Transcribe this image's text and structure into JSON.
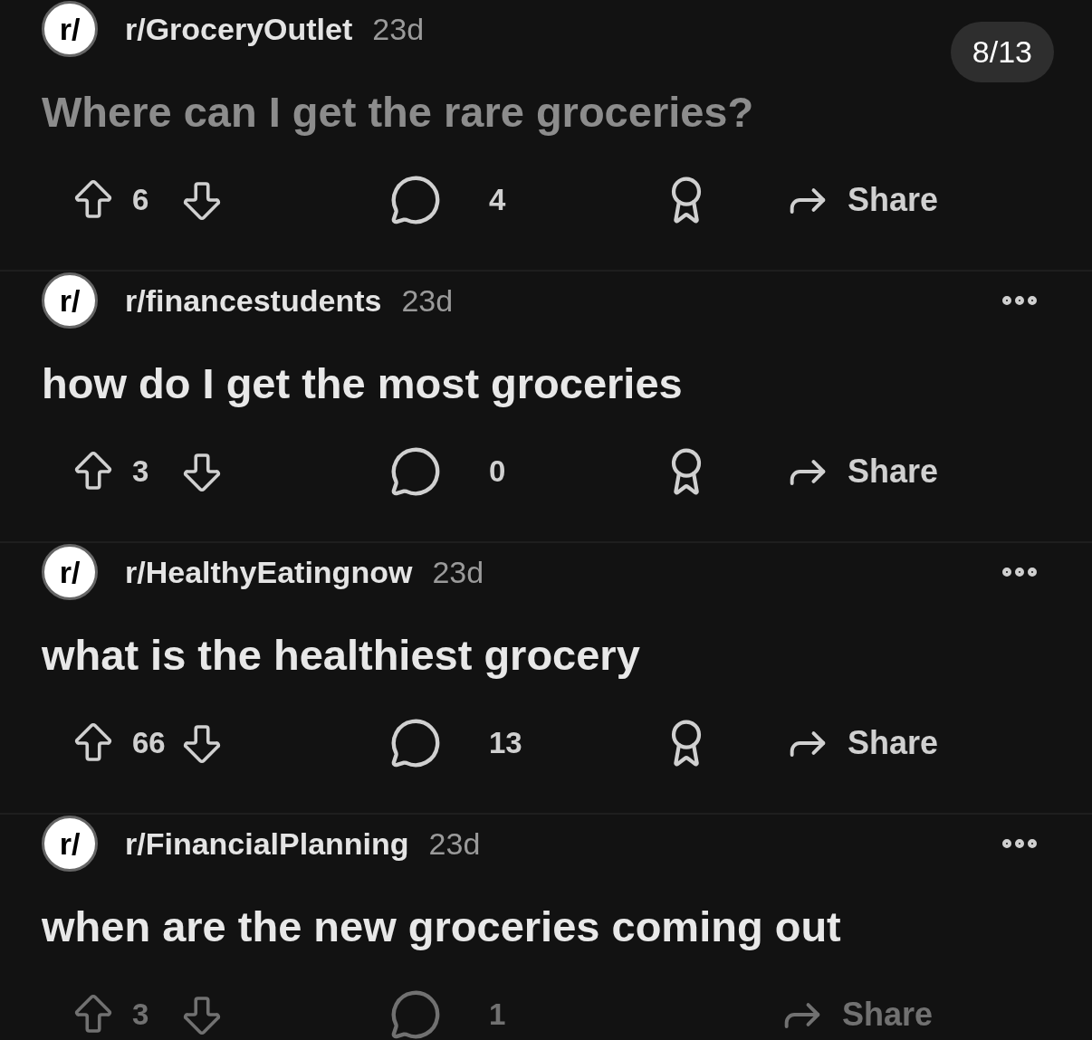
{
  "page_counter": "8/13",
  "posts": [
    {
      "icon_text": "r/",
      "subreddit": "r/GroceryOutlet",
      "age": "23d",
      "title": "Where can I get the rare groceries?",
      "visited": true,
      "more_menu": false,
      "upvotes": "6",
      "comments": "4",
      "award": true,
      "share": "Share",
      "dimmed": false
    },
    {
      "icon_text": "r/",
      "subreddit": "r/financestudents",
      "age": "23d",
      "title": "how do I get the most groceries",
      "visited": false,
      "more_menu": true,
      "upvotes": "3",
      "comments": "0",
      "award": true,
      "share": "Share",
      "dimmed": false
    },
    {
      "icon_text": "r/",
      "subreddit": "r/HealthyEatingnow",
      "age": "23d",
      "title": "what is the healthiest grocery",
      "visited": false,
      "more_menu": true,
      "upvotes": "66",
      "comments": "13",
      "award": true,
      "share": "Share",
      "dimmed": false
    },
    {
      "icon_text": "r/",
      "subreddit": "r/FinancialPlanning",
      "age": "23d",
      "title": "when are the new groceries coming out",
      "visited": false,
      "more_menu": true,
      "upvotes": "3",
      "comments": "1",
      "award": false,
      "share": "Share",
      "dimmed": true
    }
  ]
}
